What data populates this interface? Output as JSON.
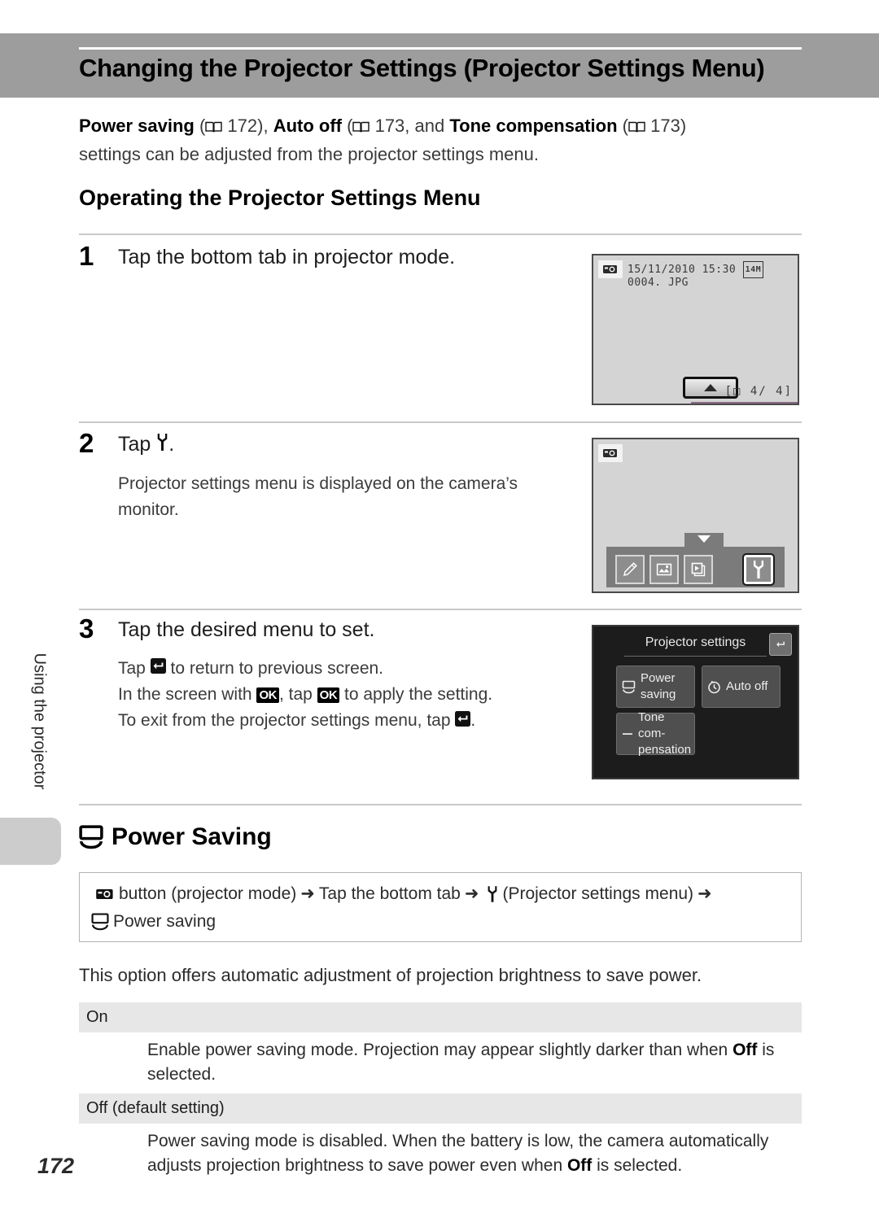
{
  "header": {
    "title": "Changing the Projector Settings (Projector Settings Menu)"
  },
  "intro": {
    "ref1_label": "Power saving",
    "ref1_page": "172",
    "ref2_label": "Auto off",
    "ref2_page": "173",
    "conjunction": ", and ",
    "ref3_label": "Tone compensation",
    "ref3_page": "173",
    "tail": "settings can be adjusted from the projector settings menu.",
    "separator1": " (",
    "separator2": "), ",
    "close_paren": ")"
  },
  "section_heading": "Operating the Projector Settings Menu",
  "steps": [
    {
      "number": "1",
      "title": "Tap the bottom tab in projector mode.",
      "body": []
    },
    {
      "number": "2",
      "title": "Tap",
      "title_suffix": ".",
      "body": [
        "Projector settings menu is displayed on the camera’s monitor."
      ]
    },
    {
      "number": "3",
      "title": "Tap the desired menu to set.",
      "body_line1_a": "Tap",
      "body_line1_b": "to return to previous screen.",
      "body_line2_a": "In the screen with",
      "body_line2_b": ", tap",
      "body_line2_c": "to apply the setting.",
      "body_line3_a": "To exit from the projector settings menu, tap",
      "body_line3_b": "."
    }
  ],
  "screen1": {
    "date": "15/11/2010",
    "time": "15:30",
    "image_size_badge": "14",
    "image_size_unit": "M",
    "filename": "0004. JPG",
    "frame_counter": "[□  4/   4]",
    "tab_icon": "up-arrow-tab"
  },
  "screen2": {
    "mode_icon": "projector-mode-icon",
    "tabs": [
      "edit-pencil-icon",
      "retouch-icon",
      "slideshow-icon",
      "setup-wrench-icon"
    ],
    "selected_tab": "setup-wrench-icon",
    "notch_icon": "down-arrow"
  },
  "screen3": {
    "title": "Projector settings",
    "back_icon": "return-icon",
    "items": [
      {
        "icon": "power-saving-icon",
        "label": "Power saving"
      },
      {
        "icon": "auto-off-icon",
        "label": "Auto off"
      },
      {
        "icon": "tone-compensation-icon",
        "label": "Tone com-\npensation"
      }
    ]
  },
  "power_saving": {
    "heading": "Power Saving",
    "heading_icon": "power-saving-icon",
    "nav_part1": "button (projector mode)",
    "nav_part2": "Tap the bottom tab",
    "nav_part3": "(Projector settings menu)",
    "nav_part4": "Power saving",
    "arrow": "➜",
    "description": "This option offers automatic adjustment of projection brightness to save power.",
    "table": [
      {
        "option": "On",
        "desc_a": "Enable power saving mode. Projection may appear slightly darker than when ",
        "desc_bold": "Off",
        "desc_b": " is selected."
      },
      {
        "option": "Off (default setting)",
        "desc_a": "Power saving mode is disabled. When the battery is low, the camera automatically adjusts projection brightness to save power even when ",
        "desc_bold": "Off",
        "desc_b": " is selected."
      }
    ]
  },
  "sidebar": {
    "chapter_label": "Using the projector"
  },
  "page_number": "172"
}
